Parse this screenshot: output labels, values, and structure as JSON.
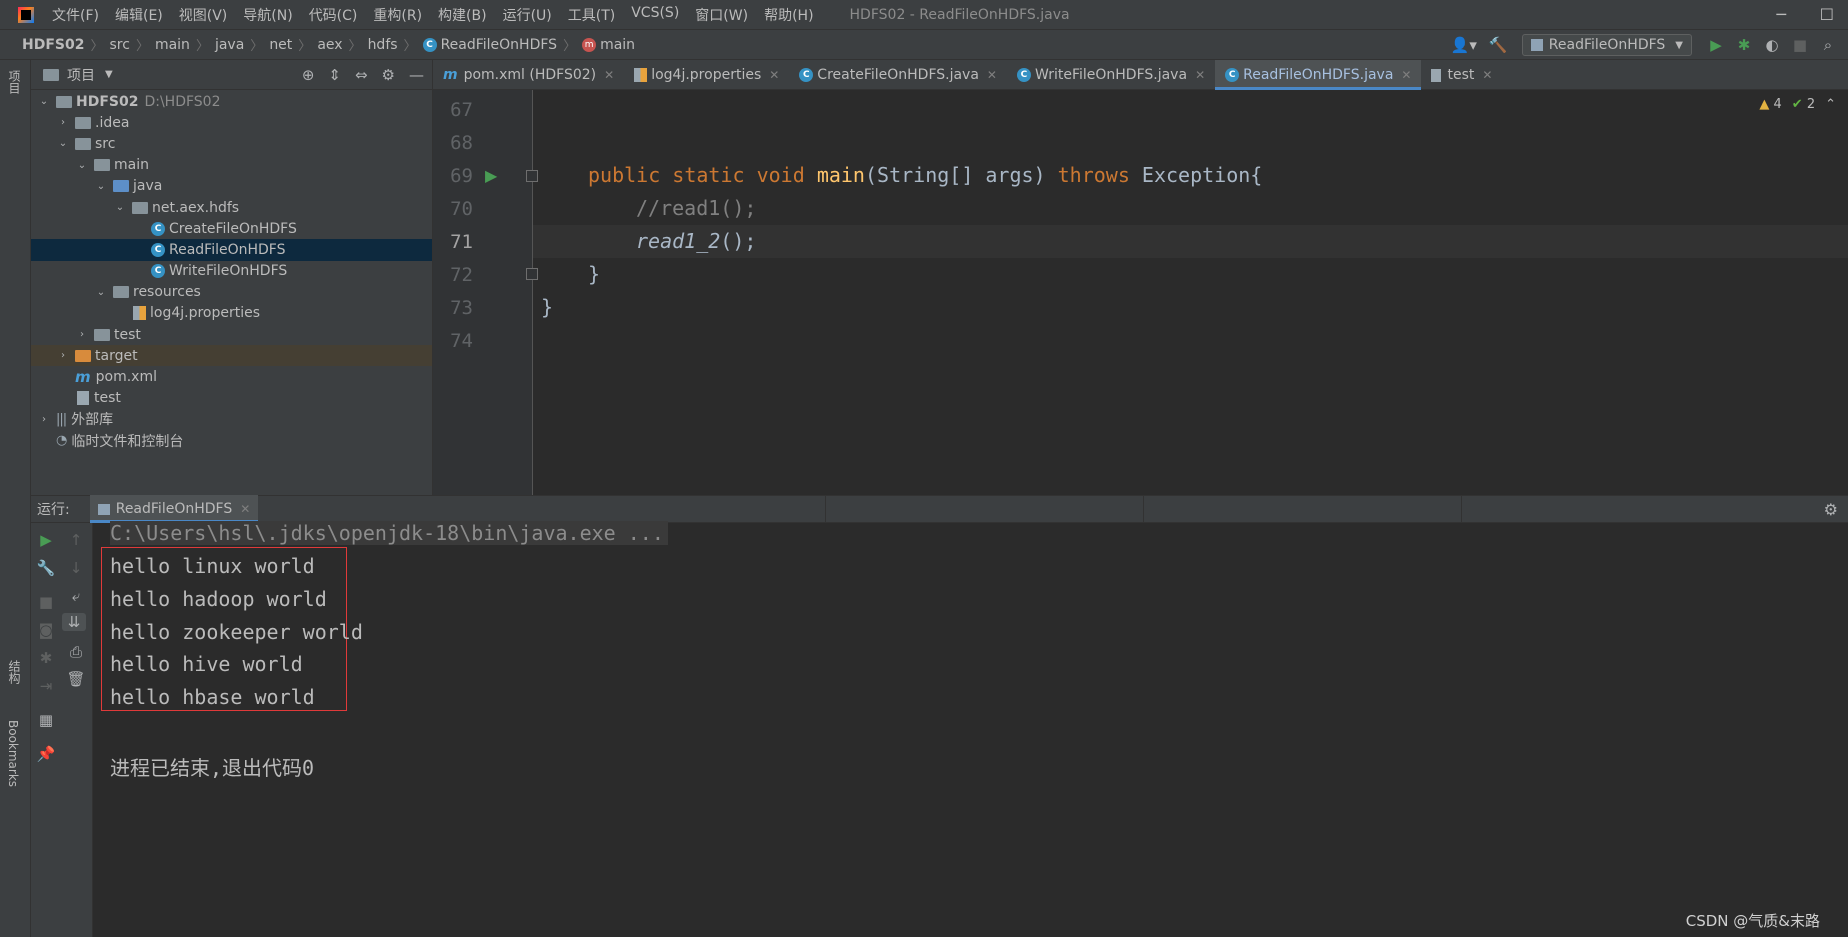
{
  "titlebar": {
    "menu": [
      "文件(F)",
      "编辑(E)",
      "视图(V)",
      "导航(N)",
      "代码(C)",
      "重构(R)",
      "构建(B)",
      "运行(U)",
      "工具(T)",
      "VCS(S)",
      "窗口(W)",
      "帮助(H)"
    ],
    "window_title": "HDFS02 - ReadFileOnHDFS.java"
  },
  "navbar": {
    "crumbs": [
      "HDFS02",
      "src",
      "main",
      "java",
      "net",
      "aex",
      "hdfs",
      "ReadFileOnHDFS",
      "main"
    ],
    "run_config": "ReadFileOnHDFS"
  },
  "left_strip": {
    "project": "项目",
    "structure": "结构",
    "bookmarks": "Bookmarks"
  },
  "project_panel": {
    "title": "项目",
    "tree": [
      {
        "label": "HDFS02",
        "path": "D:\\HDFS02"
      },
      {
        "label": ".idea"
      },
      {
        "label": "src"
      },
      {
        "label": "main"
      },
      {
        "label": "java"
      },
      {
        "label": "net.aex.hdfs"
      },
      {
        "label": "CreateFileOnHDFS"
      },
      {
        "label": "ReadFileOnHDFS"
      },
      {
        "label": "WriteFileOnHDFS"
      },
      {
        "label": "resources"
      },
      {
        "label": "log4j.properties"
      },
      {
        "label": "test"
      },
      {
        "label": "target"
      },
      {
        "label": "pom.xml"
      },
      {
        "label": "test"
      },
      {
        "label": "外部库"
      },
      {
        "label": "临时文件和控制台"
      }
    ]
  },
  "editor_tabs": [
    {
      "label": "pom.xml (HDFS02)"
    },
    {
      "label": "log4j.properties"
    },
    {
      "label": "CreateFileOnHDFS.java"
    },
    {
      "label": "WriteFileOnHDFS.java"
    },
    {
      "label": "ReadFileOnHDFS.java",
      "active": true
    },
    {
      "label": "test"
    }
  ],
  "editor": {
    "line_numbers": [
      "67",
      "68",
      "69",
      "70",
      "71",
      "72",
      "73",
      "74"
    ],
    "current_line": "71",
    "warnings": "4",
    "checks": "2",
    "code": {
      "l69_kw1": "public",
      "l69_kw2": "static",
      "l69_kw3": "void",
      "l69_fn": "main",
      "l69_params": "(String[] args) ",
      "l69_throws": "throws",
      "l69_rest": " Exception{",
      "l70": "//read1();",
      "l71_call": "read1_2",
      "l71_rest": "();",
      "l72": "}",
      "l73": "}"
    }
  },
  "run_window": {
    "label": "运行:",
    "tab": "ReadFileOnHDFS",
    "command": "C:\\Users\\hsl\\.jdks\\openjdk-18\\bin\\java.exe ...",
    "output": [
      "hello linux world",
      "hello hadoop world",
      "hello zookeeper world",
      "hello hive world",
      "hello hbase world"
    ],
    "exit_message": "进程已结束,退出代码0"
  },
  "watermark": "CSDN @气质&末路",
  "colors": {
    "accent": "#4a88c7",
    "keyword": "#cc7832",
    "function": "#ffc66d",
    "comment": "#808080",
    "highlight_box": "#e03a3a"
  }
}
